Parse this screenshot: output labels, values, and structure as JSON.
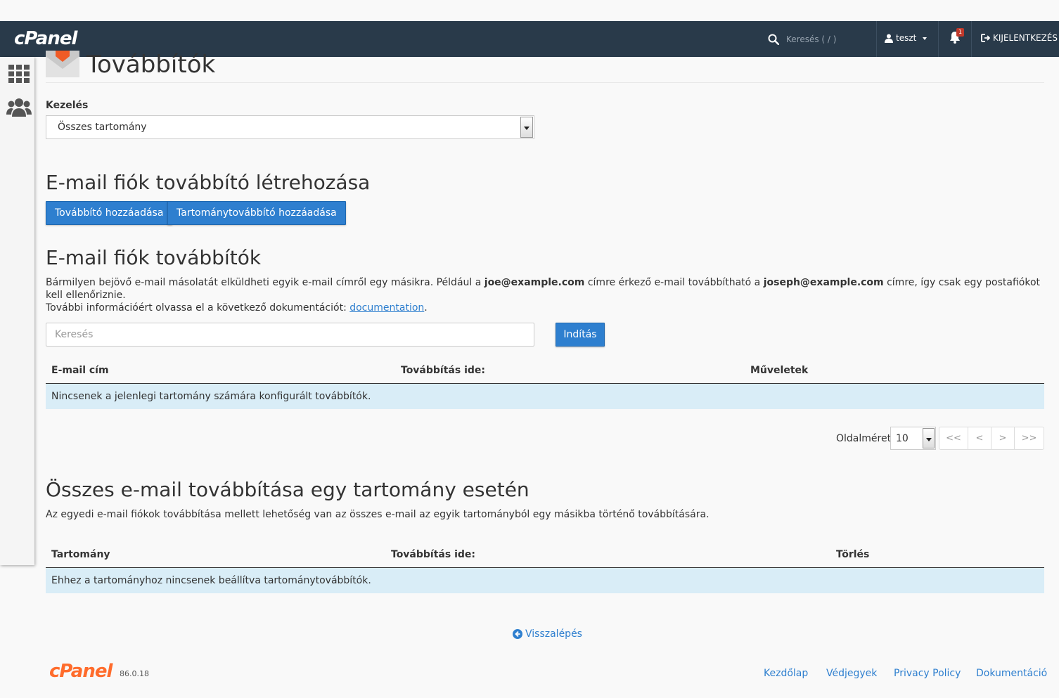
{
  "navbar": {
    "brand": "cPanel",
    "search_placeholder": "Keresés ( / )",
    "user": "teszt",
    "notification_count": "1",
    "logout": "KIJELENTKEZÉS"
  },
  "page": {
    "title": "Továbbítók",
    "manage_label": "Kezelés",
    "domain_select": "Összes tartomány"
  },
  "create_section": {
    "heading": "E-mail fiók továbbító létrehozása",
    "add_forwarder": "Továbbító hozzáadása",
    "add_domain_forwarder": "Tartománytovábbító hozzáadása"
  },
  "forwarders_section": {
    "heading": "E-mail fiók továbbítók",
    "desc_part1": "Bármilyen bejövő e-mail másolatát elküldheti egyik e-mail címről egy másikra. Például a ",
    "desc_email1": "joe@example.com",
    "desc_part2": " címre érkező e-mail továbbítható a ",
    "desc_email2": "joseph@example.com",
    "desc_part3": " címre, így csak egy postafiókot kell ellenőriznie.",
    "desc_line2": "További információért olvassa el a következő dokumentációt: ",
    "doc_link": "documentation",
    "search_placeholder": "Keresés",
    "go_button": "Indítás",
    "columns": [
      "E-mail cím",
      "Továbbítás ide:",
      "Műveletek"
    ],
    "empty_message": "Nincsenek a jelenlegi tartomány számára konfigurált továbbítók.",
    "page_size_label": "Oldalméret",
    "page_size": "10",
    "pager": [
      "<<",
      "<",
      ">",
      ">>"
    ]
  },
  "domain_section": {
    "heading": "Összes e-mail továbbítása egy tartomány esetén",
    "desc": "Az egyedi e-mail fiókok továbbítása mellett lehetőség van az összes e-mail az egyik tartományból egy másikba történő továbbítására.",
    "columns": [
      "Tartomány",
      "Továbbítás ide:",
      "Törlés"
    ],
    "empty_message": "Ehhez a tartományhoz nincsenek beállítva tartománytovábbítók."
  },
  "back_link": "Visszalépés",
  "footer": {
    "brand": "cPanel",
    "version": "86.0.18",
    "links": [
      "Kezdőlap",
      "Védjegyek",
      "Privacy Policy",
      "Dokumentáció"
    ]
  }
}
